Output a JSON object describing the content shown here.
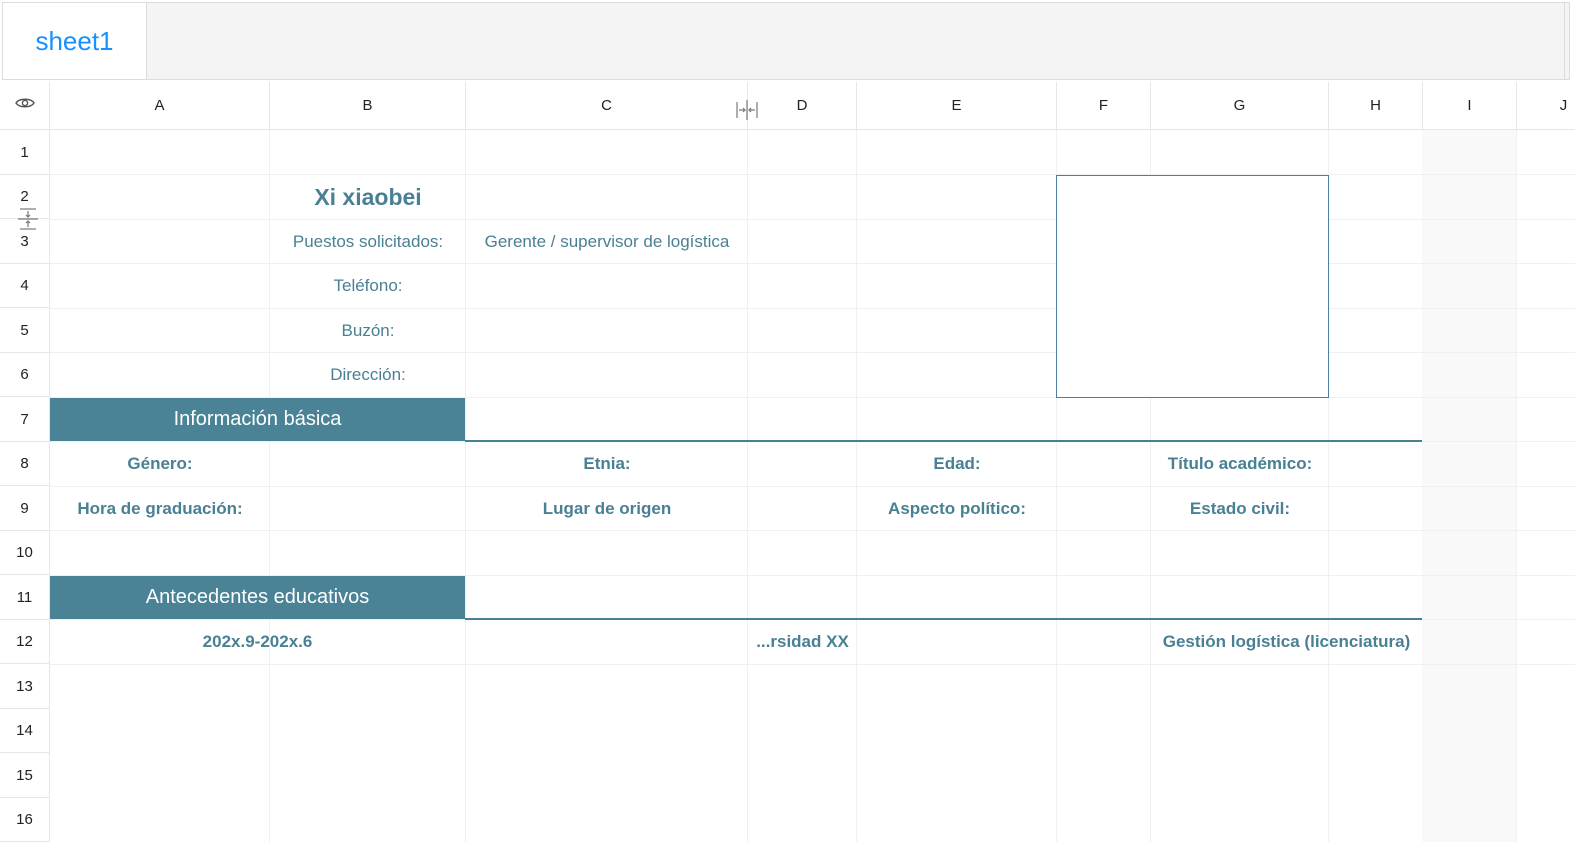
{
  "tabs": {
    "sheet": "sheet1"
  },
  "grid": {
    "columns": [
      "A",
      "B",
      "C",
      "D",
      "E",
      "F",
      "G",
      "H",
      "I",
      "J"
    ],
    "rows": [
      "1",
      "2",
      "3",
      "4",
      "5",
      "6",
      "7",
      "8",
      "9",
      "10",
      "11",
      "12",
      "13",
      "14",
      "15",
      "16"
    ]
  },
  "cells": {
    "name": "Xi xiaobei",
    "position_label": "Puestos solicitados:",
    "position_value": "Gerente / supervisor de logística",
    "phone_label": "Teléfono:",
    "mailbox_label": "Buzón:",
    "address_label": "Dirección:",
    "basic_info_header": "Información básica",
    "gender_label": "Género:",
    "ethnicity_label": "Etnia:",
    "age_label": "Edad:",
    "degree_label": "Título académico:",
    "graduation_label": "Hora de graduación:",
    "origin_label": "Lugar de origen",
    "political_label": "Aspecto político:",
    "marital_label": "Estado civil:",
    "education_header": "Antecedentes educativos",
    "edu_period": "202x.9-202x.6",
    "edu_university": "...rsidad XX",
    "edu_major": "Gestión logística (licenciatura)"
  },
  "colors": {
    "accent": "#4a8296",
    "text": "#4a8094",
    "tab_active": "#1890ff"
  }
}
